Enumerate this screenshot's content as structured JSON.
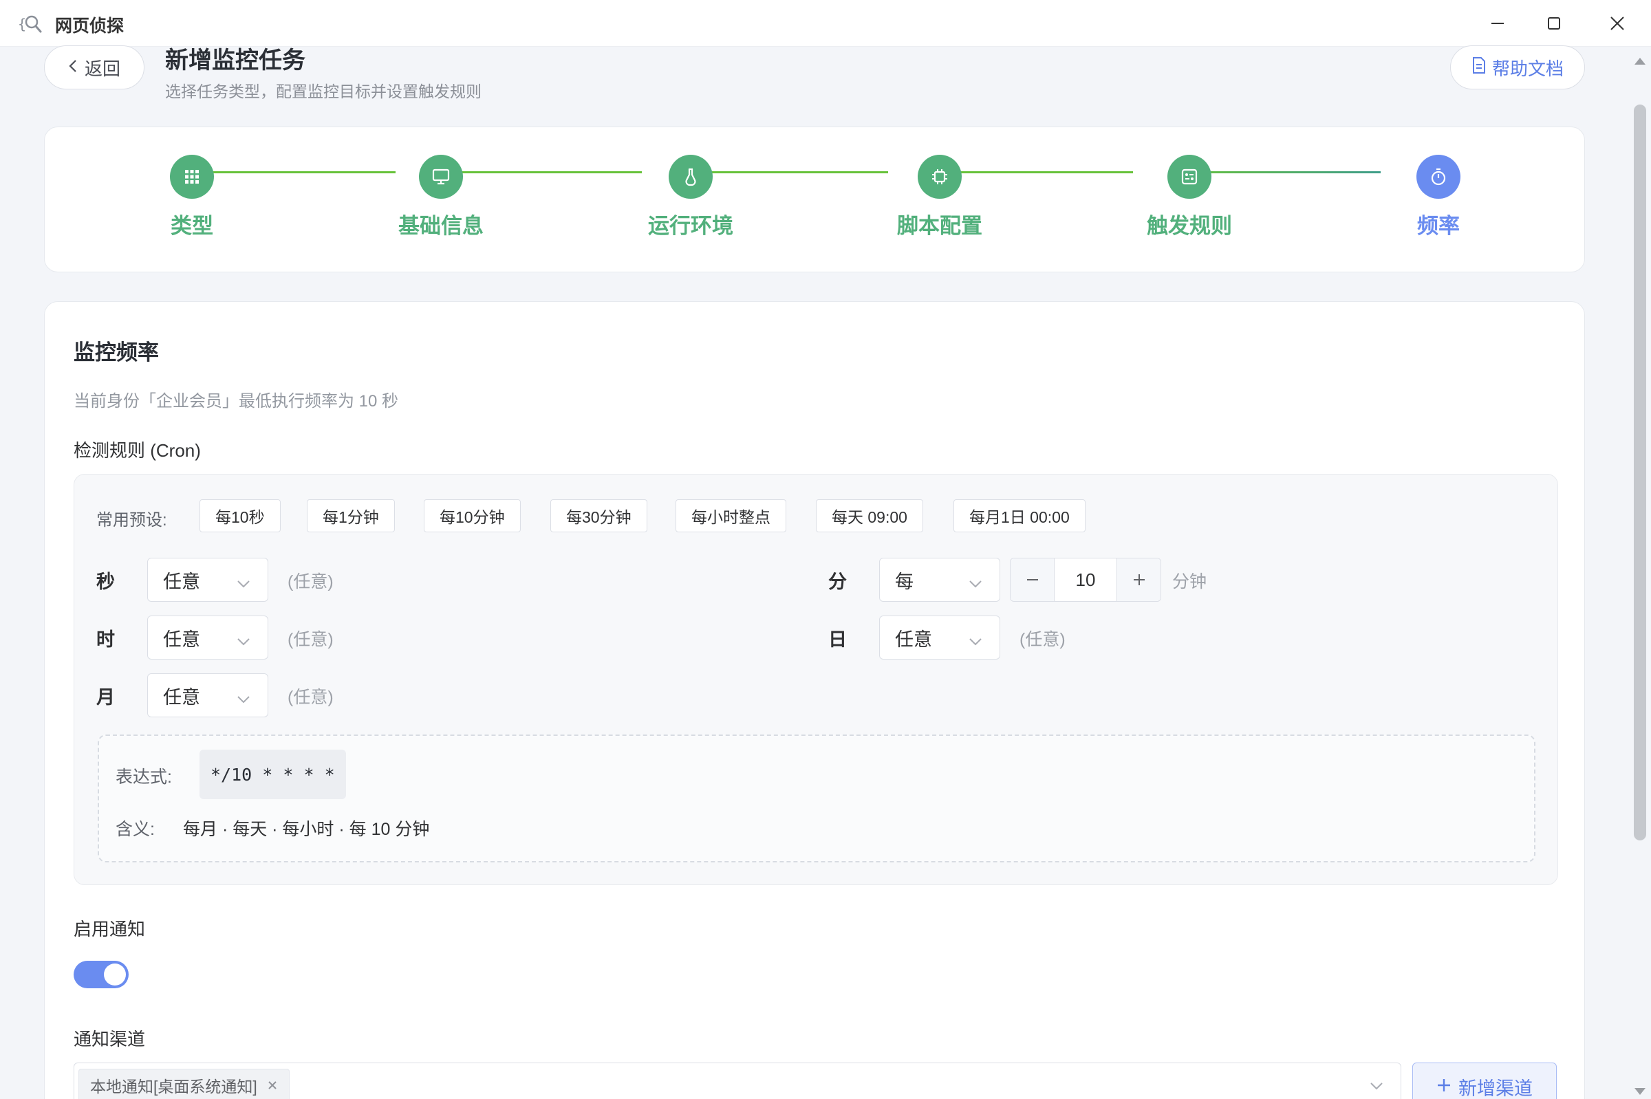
{
  "window": {
    "title": "网页侦探"
  },
  "header": {
    "back_label": "返回",
    "title": "新增监控任务",
    "subtitle": "选择任务类型，配置监控目标并设置触发规则",
    "help_label": "帮助文档"
  },
  "steps": [
    {
      "label": "类型",
      "icon": "grid-icon",
      "status": "done"
    },
    {
      "label": "基础信息",
      "icon": "monitor-icon",
      "status": "done"
    },
    {
      "label": "运行环境",
      "icon": "flask-icon",
      "status": "done"
    },
    {
      "label": "脚本配置",
      "icon": "chip-icon",
      "status": "done"
    },
    {
      "label": "触发规则",
      "icon": "rules-icon",
      "status": "done"
    },
    {
      "label": "频率",
      "icon": "stopwatch-icon",
      "status": "active"
    }
  ],
  "frequency": {
    "title": "监控频率",
    "hint": "当前身份「企业会员」最低执行频率为 10 秒",
    "rule_label": "检测规则 (Cron)",
    "presets_label": "常用预设:",
    "presets": [
      "每10秒",
      "每1分钟",
      "每10分钟",
      "每30分钟",
      "每小时整点",
      "每天 09:00",
      "每月1日 00:00"
    ],
    "second": {
      "label": "秒",
      "value": "任意",
      "hint": "(任意)"
    },
    "hour": {
      "label": "时",
      "value": "任意",
      "hint": "(任意)"
    },
    "month": {
      "label": "月",
      "value": "任意",
      "hint": "(任意)"
    },
    "minute": {
      "label": "分",
      "value": "每",
      "step_value": "10",
      "unit": "分钟"
    },
    "day": {
      "label": "日",
      "value": "任意",
      "hint": "(任意)"
    },
    "expression_label": "表达式:",
    "expression": "*/10 * * * *",
    "meaning_label": "含义:",
    "meaning": "每月 · 每天 · 每小时 · 每 10 分钟"
  },
  "notify": {
    "enable_label": "启用通知",
    "enabled": true,
    "channel_label": "通知渠道",
    "channels": [
      "本地通知[桌面系统通知]"
    ],
    "add_channel_label": "新增渠道"
  },
  "colors": {
    "step_done": "#52b07c",
    "step_active": "#6a8cf0",
    "accent": "#5b7ee6"
  }
}
